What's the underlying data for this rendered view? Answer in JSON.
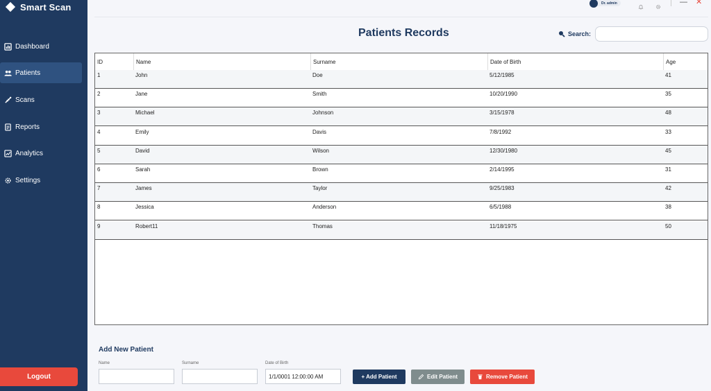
{
  "app": {
    "title": "Smart Scan"
  },
  "sidebar": {
    "items": [
      {
        "label": "Dashboard",
        "icon": "dashboard-icon",
        "active": false
      },
      {
        "label": "Patients",
        "icon": "users-icon",
        "active": true
      },
      {
        "label": "Scans",
        "icon": "scan-icon",
        "active": false
      },
      {
        "label": "Reports",
        "icon": "report-icon",
        "active": false
      },
      {
        "label": "Analytics",
        "icon": "analytics-icon",
        "active": false
      },
      {
        "label": "Settings",
        "icon": "gear-icon",
        "active": false
      }
    ],
    "logout_label": "Logout"
  },
  "topbar": {
    "user_name": "Dr. admin",
    "icons": [
      "bell-icon",
      "gear-icon"
    ],
    "window_controls": {
      "minimize": "—",
      "close": "✕"
    }
  },
  "main": {
    "title": "Patients Records",
    "search": {
      "label": "Search:",
      "value": "",
      "placeholder": ""
    }
  },
  "table": {
    "columns": [
      "ID",
      "Name",
      "Surname",
      "Date of Birth",
      "Age"
    ],
    "rows": [
      [
        "1",
        "John",
        "Doe",
        "5/12/1985",
        "41"
      ],
      [
        "2",
        "Jane",
        "Smith",
        "10/20/1990",
        "35"
      ],
      [
        "3",
        "Michael",
        "Johnson",
        "3/15/1978",
        "48"
      ],
      [
        "4",
        "Emily",
        "Davis",
        "7/8/1992",
        "33"
      ],
      [
        "5",
        "David",
        "Wilson",
        "12/30/1980",
        "45"
      ],
      [
        "6",
        "Sarah",
        "Brown",
        "2/14/1995",
        "31"
      ],
      [
        "7",
        "James",
        "Taylor",
        "9/25/1983",
        "42"
      ],
      [
        "8",
        "Jessica",
        "Anderson",
        "6/5/1988",
        "38"
      ],
      [
        "9",
        "Robert11",
        "Thomas",
        "11/18/1975",
        "50"
      ]
    ]
  },
  "form": {
    "title": "Add New Patient",
    "fields": {
      "name": {
        "label": "Name",
        "value": ""
      },
      "surname": {
        "label": "Surname",
        "value": ""
      },
      "dob": {
        "label": "Date of Birth",
        "value": "1/1/0001 12:00:00 AM"
      }
    },
    "buttons": {
      "add": "+ Add Patient",
      "edit": "Edit Patient",
      "remove": "Remove Patient"
    }
  },
  "colors": {
    "sidebar_bg": "#1f3a60",
    "accent": "#1f3a60",
    "danger": "#e8493c",
    "muted_button": "#7f8c8d"
  }
}
